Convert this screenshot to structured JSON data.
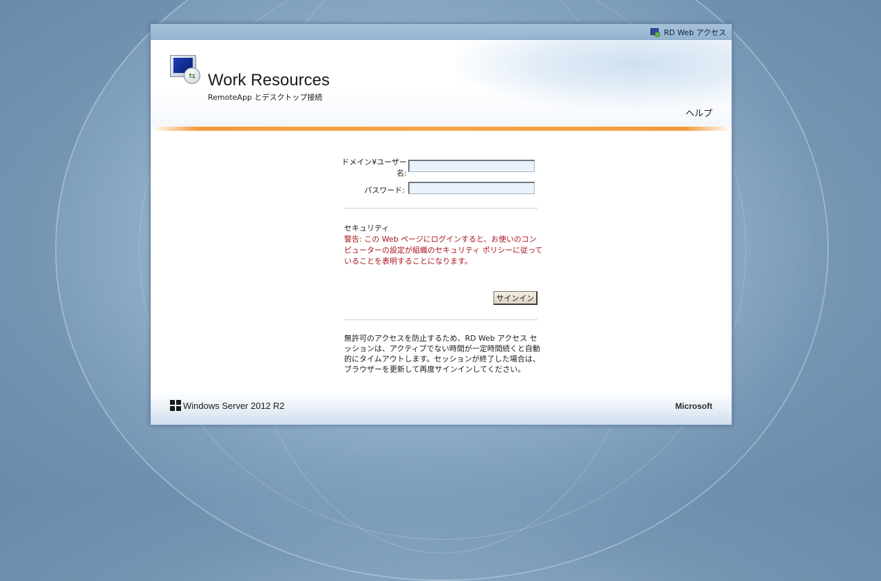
{
  "topbar": {
    "rdweb_label": "RD Web アクセス",
    "rdweb_icon": "rd-web-icon"
  },
  "header": {
    "title": "Work Resources",
    "subtitle": "RemoteApp とデスクトップ接続",
    "help_label": "ヘルプ",
    "logo_icon": "remote-desktop-monitor-icon"
  },
  "form": {
    "username_label_line1": "ドメイン¥ユーザー",
    "username_label_line2": "名:",
    "username_value": "",
    "password_label": "パスワード:",
    "password_value": ""
  },
  "security": {
    "title": "セキュリティ",
    "warning": "警告: この Web ページにログインすると、お使いのコンピューターの設定が組織のセキュリティ ポリシーに従っていることを表明することになります。"
  },
  "signin_label": "サインイン",
  "timeout_note": "無許可のアクセスを防止するため、RD Web アクセス セッションは、アクティブでない時間が一定時間続くと自動的にタイムアウトします。セッションが終了した場合は、ブラウザーを更新して再度サインインしてください。",
  "footer": {
    "product": "Windows Server 2012 R2",
    "vendor": "Microsoft",
    "windows_icon": "windows-logo-icon"
  },
  "colors": {
    "accent_orange": "#f39b3a",
    "warning_red": "#a8131d",
    "background_blue": "#7f9fbd"
  }
}
